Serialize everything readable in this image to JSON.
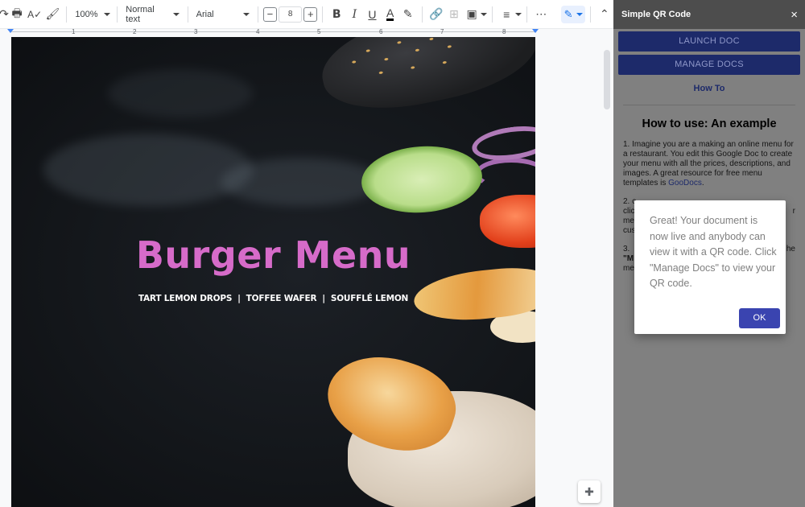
{
  "toolbar": {
    "zoom": "100%",
    "style": "Normal text",
    "font": "Arial",
    "font_size": "8",
    "decrease_label": "−",
    "increase_label": "+",
    "bold": "B",
    "italic": "I",
    "underline": "U",
    "text_color": "A",
    "more": "⋯"
  },
  "ruler": {
    "numbers": [
      "1",
      "2",
      "3",
      "4",
      "5",
      "6",
      "7",
      "8"
    ]
  },
  "document": {
    "title": "Burger Menu",
    "subtitle": "TART LEMON DROPS  |  TOFFEE WAFER  |  SOUFFLÉ LEMON"
  },
  "panel": {
    "title": "Simple QR Code",
    "close": "×",
    "launch_button": "LAUNCH DOC",
    "manage_button": "MANAGE DOCS",
    "how_to_link": "How To",
    "example_title": "How to use: An example",
    "step1_text": "1. Imagine you are a making an online menu for a restaurant. You edit this Google Doc to create your menu with all the prices, descriptions, and images. A great resource for free menu templates is ",
    "step1_link": "GooDocs",
    "step1_end": ".",
    "step2_text": "2. c",
    "step2_line2": "clic",
    "step2_line2_end": "r",
    "step2_line3": "me",
    "step2_line4": "cus",
    "step3_text": "3.",
    "step3_end": "he",
    "step3_line2": "\"M",
    "step3_line3": "me"
  },
  "dialog": {
    "message": "Great! Your document is now live and anybody can view it with a QR code. Click \"Manage Docs\" to view your QR code.",
    "ok": "OK"
  },
  "colors": {
    "title_pink": "#d66bc9",
    "panel_bg": "#808080",
    "panel_header": "#4d4d4d",
    "button_navy": "#1d2a6a",
    "ok_blue": "#3a44b0"
  }
}
